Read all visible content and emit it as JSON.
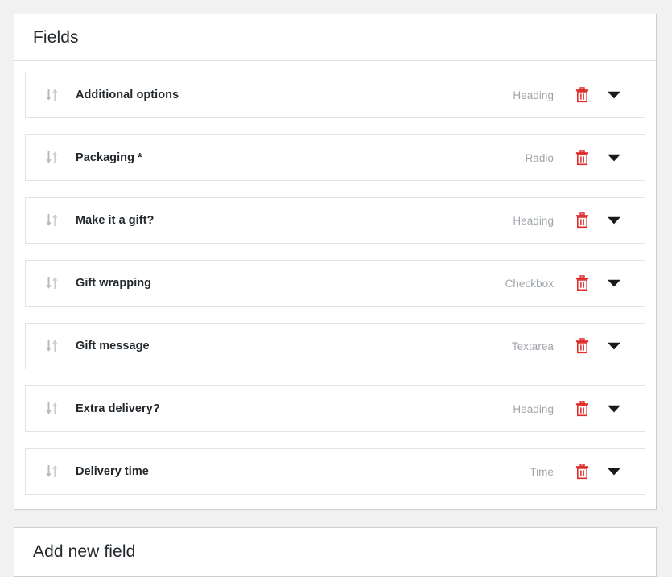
{
  "fields_panel": {
    "title": "Fields",
    "rows": [
      {
        "label": "Additional options",
        "type": "Heading",
        "sort_icon": "sort-arrows-icon",
        "delete_icon": "trash-icon",
        "expand_icon": "chevron-down-icon"
      },
      {
        "label": "Packaging *",
        "type": "Radio",
        "sort_icon": "sort-arrows-icon",
        "delete_icon": "trash-icon",
        "expand_icon": "chevron-down-icon"
      },
      {
        "label": "Make it a gift?",
        "type": "Heading",
        "sort_icon": "sort-arrows-icon",
        "delete_icon": "trash-icon",
        "expand_icon": "chevron-down-icon"
      },
      {
        "label": "Gift wrapping",
        "type": "Checkbox",
        "sort_icon": "sort-arrows-icon",
        "delete_icon": "trash-icon",
        "expand_icon": "chevron-down-icon"
      },
      {
        "label": "Gift message",
        "type": "Textarea",
        "sort_icon": "sort-arrows-icon",
        "delete_icon": "trash-icon",
        "expand_icon": "chevron-down-icon"
      },
      {
        "label": "Extra delivery?",
        "type": "Heading",
        "sort_icon": "sort-arrows-icon",
        "delete_icon": "trash-icon",
        "expand_icon": "chevron-down-icon"
      },
      {
        "label": "Delivery time",
        "type": "Time",
        "sort_icon": "sort-arrows-icon",
        "delete_icon": "trash-icon",
        "expand_icon": "chevron-down-icon"
      }
    ]
  },
  "add_new_panel": {
    "title": "Add new field"
  },
  "colors": {
    "page_background": "#f1f1f1",
    "panel_background": "#ffffff",
    "panel_border": "#cccccc",
    "row_border": "#e2e2e2",
    "label_text": "#23282d",
    "type_text": "#a0a5aa",
    "sort_arrow_down": "#b4b9be",
    "sort_arrow_up": "#c9ced3",
    "trash_icon": "#e02b2b",
    "chevron_icon": "#1a1a1a"
  }
}
